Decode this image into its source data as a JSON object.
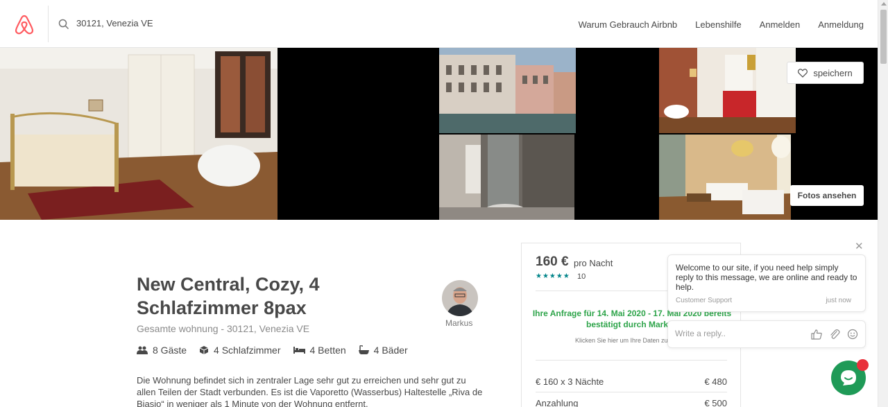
{
  "header": {
    "search_value": "30121, Venezia VE",
    "nav": [
      "Warum Gebrauch Airbnb",
      "Lebenshilfe",
      "Anmelden",
      "Anmeldung"
    ]
  },
  "gallery": {
    "save_label": "speichern",
    "view_photos_label": "Fotos ansehen"
  },
  "listing": {
    "title": "New Central, Cozy, 4 Schlafzimmer 8pax",
    "subtitle": "Gesamte wohnung - 30121, Venezia VE",
    "host_name": "Markus",
    "amenities": [
      {
        "icon": "guests-icon",
        "label": "8 Gäste"
      },
      {
        "icon": "bedroom-icon",
        "label": "4 Schlafzimmer"
      },
      {
        "icon": "bed-icon",
        "label": "4 Betten"
      },
      {
        "icon": "bath-icon",
        "label": "4 Bäder"
      }
    ],
    "description": "Die Wohnung befindet sich in zentraler Lage sehr gut zu erreichen und sehr gut zu allen Teilen der Stadt verbunden. Es ist die Vaporetto (Wasserbus) Haltestelle „Riva de Biasio“ in weniger als 1 Minute von der Wohnung entfernt."
  },
  "booking": {
    "price": "160 €",
    "price_unit": "pro Nacht",
    "stars": "★★★★★",
    "rating": 5,
    "review_count": "10",
    "confirmation": "Ihre Anfrage für 14. Mai 2020 - 17. Mai 2020 bereits bestätigt durch Markus",
    "confirmation_hint": "Klicken Sie hier um Ihre Daten zu ändern",
    "line_items": [
      {
        "label": "€ 160 x 3 Nächte",
        "amount": "€ 480"
      },
      {
        "label": "Anzahlung",
        "amount": "€ 500"
      }
    ]
  },
  "chat": {
    "message": "Welcome to our site, if you need help simply reply to this message, we are online and ready to help.",
    "sender": "Customer Support",
    "time": "just now",
    "reply_placeholder": "Write a reply.."
  },
  "colors": {
    "brand": "#ff5a5f",
    "teal": "#008489",
    "confirm_green": "#2ea44a",
    "chat_green": "#1f9a57",
    "badge_red": "#e8303b"
  }
}
